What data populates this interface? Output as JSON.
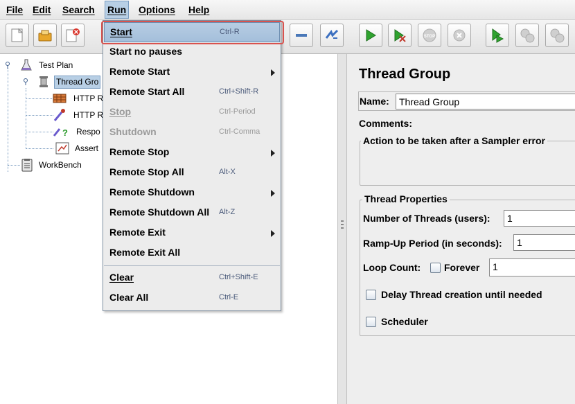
{
  "menubar": {
    "items": [
      {
        "label": "File"
      },
      {
        "label": "Edit"
      },
      {
        "label": "Search"
      },
      {
        "label": "Run"
      },
      {
        "label": "Options"
      },
      {
        "label": "Help"
      }
    ]
  },
  "toolbar": {
    "buttons": [
      "new-icon",
      "templates-icon",
      "close-icon",
      "save-icon",
      "collapse-icon",
      "toggle-icon",
      "start-icon",
      "start-no-pauses-icon",
      "stop-icon",
      "shutdown-icon",
      "remote-start-all-icon",
      "remote-stop-all-icon",
      "remote-shutdown-all-icon"
    ]
  },
  "tree": {
    "nodes": [
      {
        "label": "Test Plan",
        "icon": "flask-icon"
      },
      {
        "label": "Thread Gro",
        "icon": "spool-icon"
      },
      {
        "label": "HTTP R",
        "icon": "http-defaults-icon"
      },
      {
        "label": "HTTP R",
        "icon": "pipette-icon"
      },
      {
        "label": "Respo",
        "icon": "assertion-icon"
      },
      {
        "label": "Assert",
        "icon": "chart-icon"
      },
      {
        "label": "WorkBench",
        "icon": "clipboard-icon"
      }
    ]
  },
  "run_menu": {
    "items": [
      {
        "label": "Start",
        "shortcut": "Ctrl-R"
      },
      {
        "label": "Start no pauses",
        "shortcut": ""
      },
      {
        "label": "Remote Start",
        "shortcut": ""
      },
      {
        "label": "Remote Start All",
        "shortcut": "Ctrl+Shift-R"
      },
      {
        "label": "Stop",
        "shortcut": "Ctrl-Period"
      },
      {
        "label": "Shutdown",
        "shortcut": "Ctrl-Comma"
      },
      {
        "label": "Remote Stop",
        "shortcut": ""
      },
      {
        "label": "Remote Stop All",
        "shortcut": "Alt-X"
      },
      {
        "label": "Remote Shutdown",
        "shortcut": ""
      },
      {
        "label": "Remote Shutdown All",
        "shortcut": "Alt-Z"
      },
      {
        "label": "Remote Exit",
        "shortcut": ""
      },
      {
        "label": "Remote Exit All",
        "shortcut": ""
      },
      {
        "label": "Clear",
        "shortcut": "Ctrl+Shift-E"
      },
      {
        "label": "Clear All",
        "shortcut": "Ctrl-E"
      }
    ]
  },
  "thread_group": {
    "title": "Thread Group",
    "name_label": "Name:",
    "name_value": "Thread Group",
    "comments_label": "Comments:",
    "sampler_error_legend": "Action to be taken after a Sampler error",
    "thread_properties_legend": "Thread Properties",
    "threads_label": "Number of Threads (users):",
    "threads_value": "1",
    "rampup_label": "Ramp-Up Period (in seconds):",
    "rampup_value": "1",
    "loop_label": "Loop Count:",
    "forever_label": "Forever",
    "loop_value": "1",
    "delay_label": "Delay Thread creation until needed",
    "scheduler_label": "Scheduler"
  },
  "colors": {
    "highlight": "#b8cfe5",
    "callout": "#d9534f",
    "start_green": "#2fa32f"
  }
}
